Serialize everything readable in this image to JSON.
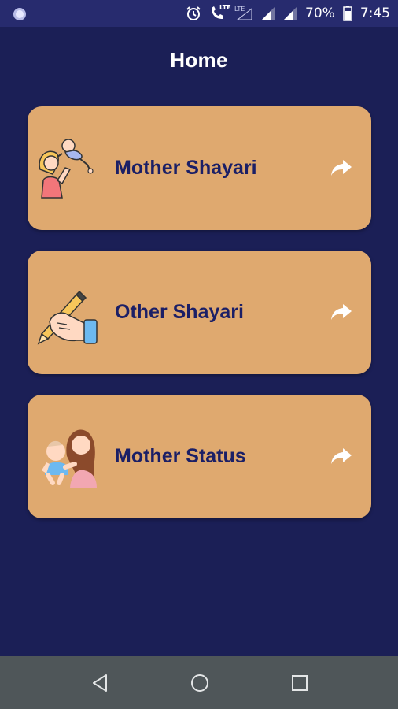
{
  "status_bar": {
    "network_label": "LTE",
    "network_label_2": "LTE",
    "battery": "70%",
    "time": "7:45"
  },
  "header": {
    "title": "Home"
  },
  "cards": [
    {
      "label": "Mother Shayari",
      "icon": "mother-child-play-icon"
    },
    {
      "label": "Other Shayari",
      "icon": "hand-writing-pen-icon"
    },
    {
      "label": "Mother Status",
      "icon": "mother-baby-icon"
    }
  ],
  "colors": {
    "background": "#1b1f56",
    "status_bar": "#272b6e",
    "card": "#dfa96f",
    "card_text": "#1b1f66",
    "nav_bar": "#4f5659"
  }
}
